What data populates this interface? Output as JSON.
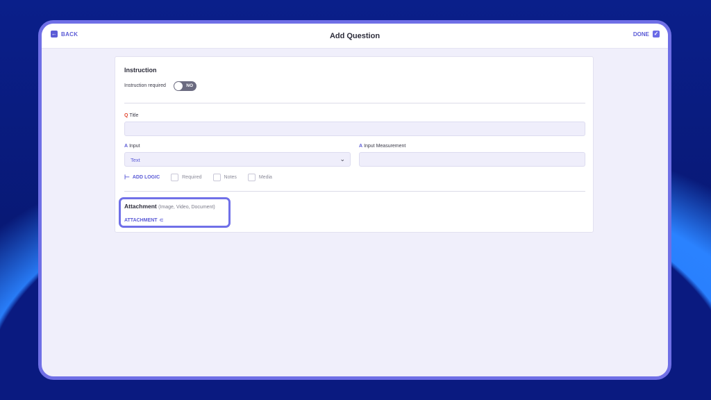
{
  "header": {
    "back_label": "BACK",
    "title": "Add Question",
    "done_label": "DONE"
  },
  "instruction": {
    "section_title": "Instruction",
    "required_label": "Instruction required",
    "toggle_text": "NO"
  },
  "question": {
    "title_prefix": "Q",
    "title_label": "Title",
    "title_value": "",
    "input_prefix": "A",
    "input_label": "Input",
    "input_value": "Text",
    "measurement_prefix": "A",
    "measurement_label": "Input Measurement",
    "measurement_value": ""
  },
  "logic": {
    "add_logic_label": "ADD LOGIC",
    "checkboxes": [
      {
        "label": "Required",
        "checked": false
      },
      {
        "label": "Notes",
        "checked": false
      },
      {
        "label": "Media",
        "checked": false
      }
    ]
  },
  "attachment": {
    "title": "Attachment",
    "hint": "(Image, Video, Document)",
    "button_label": "ATTACHMENT"
  },
  "colors": {
    "accent": "#5b5bd6",
    "frame": "#6f6fe6",
    "screen_bg": "#f0effb",
    "toggle_off": "#6b6b80",
    "question_mark": "#e2472f"
  },
  "icons": [
    "back-arrow-icon",
    "checkmark-icon",
    "chevron-down-icon",
    "logic-branch-icon",
    "paperclip-icon"
  ]
}
